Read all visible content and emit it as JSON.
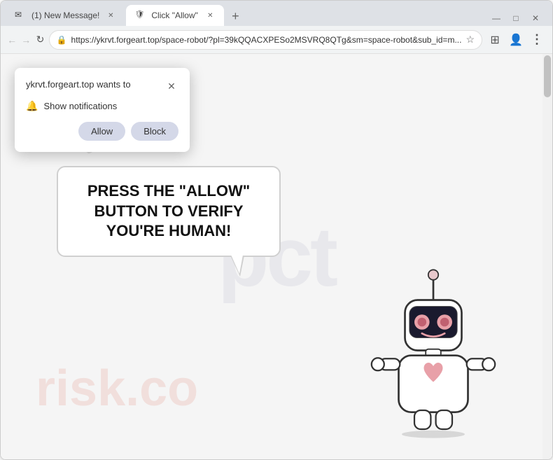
{
  "browser": {
    "tabs": [
      {
        "id": "tab1",
        "title": "(1) New Message!",
        "favicon": "✉",
        "active": false
      },
      {
        "id": "tab2",
        "title": "Click \"Allow\"",
        "favicon": "🔒",
        "active": true
      }
    ],
    "new_tab_label": "+",
    "window_controls": {
      "minimize": "—",
      "maximize": "□",
      "close": "✕"
    },
    "nav": {
      "back": "←",
      "forward": "→",
      "reload": "↻"
    },
    "url": "https://ykrvt.forgeart.top/space-robot/?pl=39kQQACXPESo2MSVRQ8QTg&sm=space-robot&sub_id=m...",
    "url_icon": "🔒",
    "star_icon": "☆",
    "extensions_icon": "⊞",
    "profile_icon": "👤",
    "menu_icon": "⋮"
  },
  "permission_popup": {
    "title": "ykrvt.forgeart.top wants to",
    "close_icon": "✕",
    "notification_icon": "🔔",
    "notification_text": "Show notifications",
    "allow_label": "Allow",
    "block_label": "Block"
  },
  "page": {
    "speech_bubble_text": "PRESS THE \"ALLOW\" BUTTON TO VERIFY YOU'RE HUMAN!",
    "watermark_text": "pct",
    "risk_watermark": "risk.co"
  }
}
